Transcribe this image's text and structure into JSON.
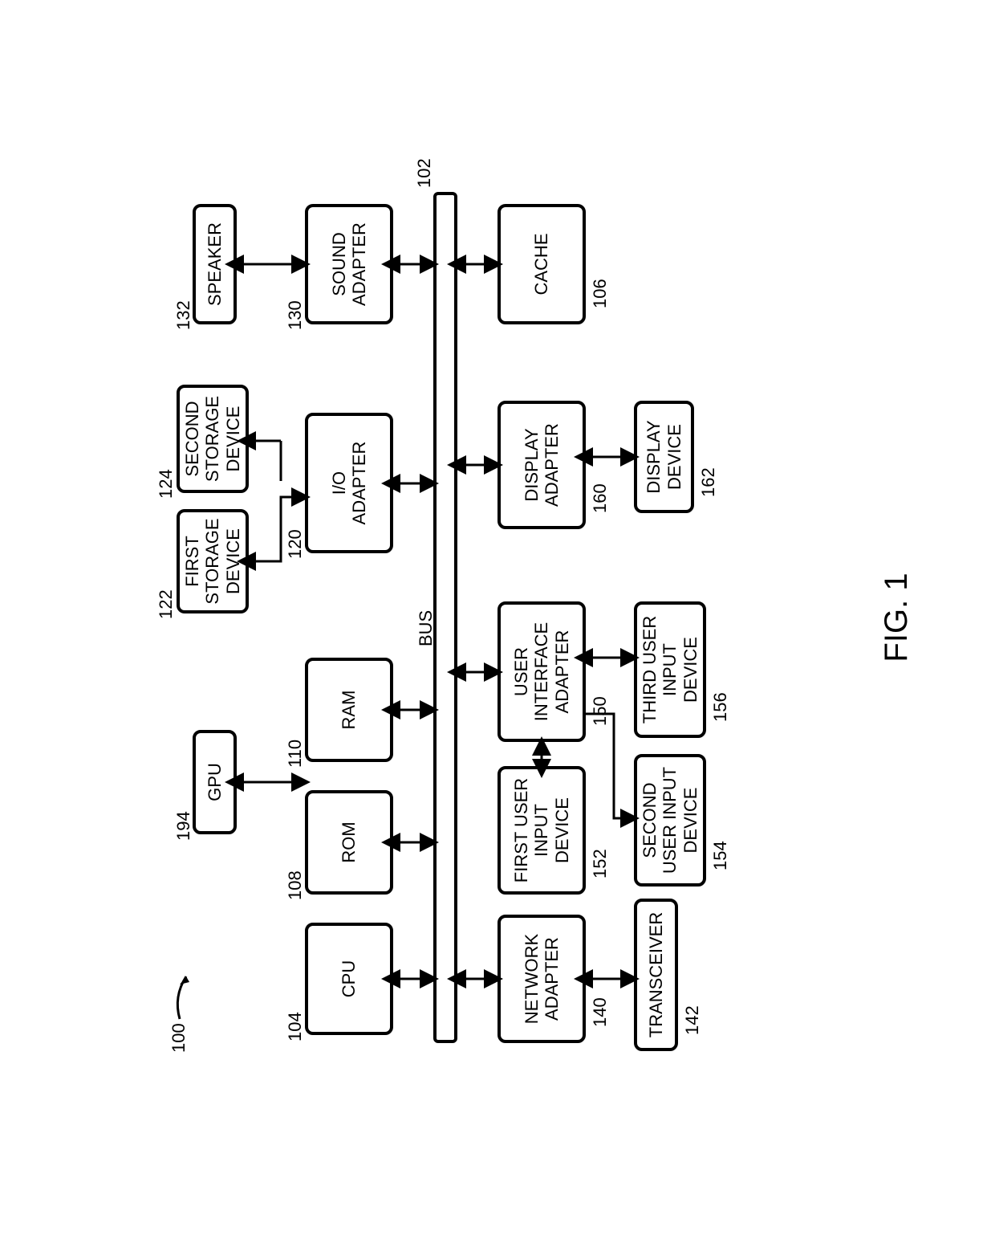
{
  "figure_label": "FIG. 1",
  "system_ref": "100",
  "bus": {
    "label": "BUS",
    "ref": "102"
  },
  "blocks": {
    "cpu": {
      "label": "CPU",
      "ref": "104"
    },
    "gpu": {
      "label": "GPU",
      "ref": "194"
    },
    "rom": {
      "label": "ROM",
      "ref": "108"
    },
    "ram": {
      "label": "RAM",
      "ref": "110"
    },
    "io_adapter": {
      "label": "I/O\nADAPTER",
      "ref": "120"
    },
    "first_storage": {
      "label": "FIRST\nSTORAGE\nDEVICE",
      "ref": "122"
    },
    "second_storage": {
      "label": "SECOND\nSTORAGE\nDEVICE",
      "ref": "124"
    },
    "sound_adapter": {
      "label": "SOUND\nADAPTER",
      "ref": "130"
    },
    "speaker": {
      "label": "SPEAKER",
      "ref": "132"
    },
    "network_adapter": {
      "label": "NETWORK\nADAPTER",
      "ref": "140"
    },
    "transceiver": {
      "label": "TRANSCEIVER",
      "ref": "142"
    },
    "ui_adapter": {
      "label": "USER\nINTERFACE\nADAPTER",
      "ref": "150"
    },
    "first_user_input": {
      "label": "FIRST USER\nINPUT\nDEVICE",
      "ref": "152"
    },
    "second_user_input": {
      "label": "SECOND\nUSER INPUT\nDEVICE",
      "ref": "154"
    },
    "third_user_input": {
      "label": "THIRD USER\nINPUT\nDEVICE",
      "ref": "156"
    },
    "display_adapter": {
      "label": "DISPLAY\nADAPTER",
      "ref": "160"
    },
    "display_device": {
      "label": "DISPLAY\nDEVICE",
      "ref": "162"
    },
    "cache": {
      "label": "CACHE",
      "ref": "106"
    }
  }
}
